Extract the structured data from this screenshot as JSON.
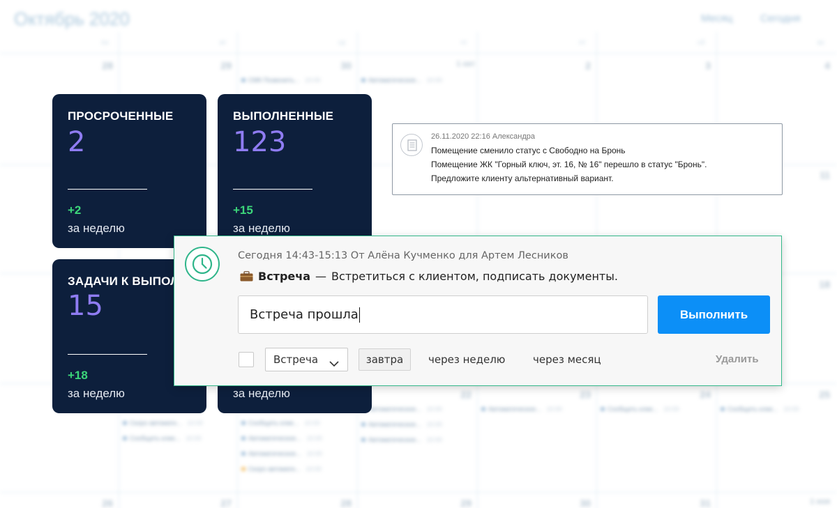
{
  "calendar": {
    "title": "Октябрь 2020",
    "view_label": "Месяц",
    "today_label": "Сегодня",
    "weekdays": [
      "пн",
      "вт",
      "ср",
      "чт",
      "пт",
      "сб",
      "вс"
    ],
    "week1_days": [
      "28",
      "29",
      "30",
      "1 окт",
      "2",
      "3",
      "4"
    ],
    "week2_day_right": "11",
    "week3_day_right": "18",
    "week4_days": [
      "22",
      "23",
      "24",
      "25"
    ],
    "week5_days": [
      "26",
      "27",
      "28",
      "29",
      "30",
      "31",
      "1 ноя"
    ],
    "events_top": [
      {
        "text": "СМК Позвонить...",
        "time": "10:00"
      },
      {
        "text": "Автоматическое...",
        "time": "10:00"
      }
    ],
    "events_bottom": [
      {
        "text": "Скоро автомати...",
        "time": "10:00"
      },
      {
        "text": "Сообщить клие...",
        "time": "10:00"
      },
      {
        "text": "Автоматическое...",
        "time": "10:00"
      }
    ]
  },
  "cards": [
    {
      "title": "ПРОСРОЧЕННЫЕ",
      "value": "2",
      "delta": "+2",
      "period": "за неделю"
    },
    {
      "title": "ВЫПОЛНЕННЫЕ",
      "value": "123",
      "delta": "+15",
      "period": "за неделю"
    },
    {
      "title": "ЗАДАЧИ К ВЫПОЛНЕНИЮ",
      "value": "15",
      "delta": "+18",
      "period": "за неделю"
    },
    {
      "title": "",
      "value": "",
      "delta": "",
      "period": "за неделю"
    }
  ],
  "notice": {
    "icon": "document-icon",
    "meta": "26.11.2020 22:16 Александра",
    "lines": [
      "Помещение сменило статус с Свободно на Бронь",
      "Помещение ЖК \"Горный ключ, эт. 16, № 16\" перешло в статус \"Бронь\".",
      "Предложите клиенту альтернативный вариант."
    ]
  },
  "task": {
    "icon": "clock-icon",
    "meta": "Сегодня 14:43-15:13 От Алёна Кучменко для Артем Лесников",
    "type_icon": "briefcase-icon",
    "type": "Встреча",
    "dash": "—",
    "description": "Встретиться с клиентом, подписать документы.",
    "result_value": "Встреча прошла",
    "submit_label": "Выполнить",
    "next_type_selected": "Встреча",
    "tomorrow_label": "завтра",
    "week_label": "через неделю",
    "month_label": "через месяц",
    "delete_label": "Удалить"
  },
  "colors": {
    "card_bg": "#0d1f3c",
    "card_value": "#8f7cf2",
    "card_delta": "#3cd67a",
    "accent_green": "#2fb58a",
    "button_blue": "#0c8ff7"
  }
}
